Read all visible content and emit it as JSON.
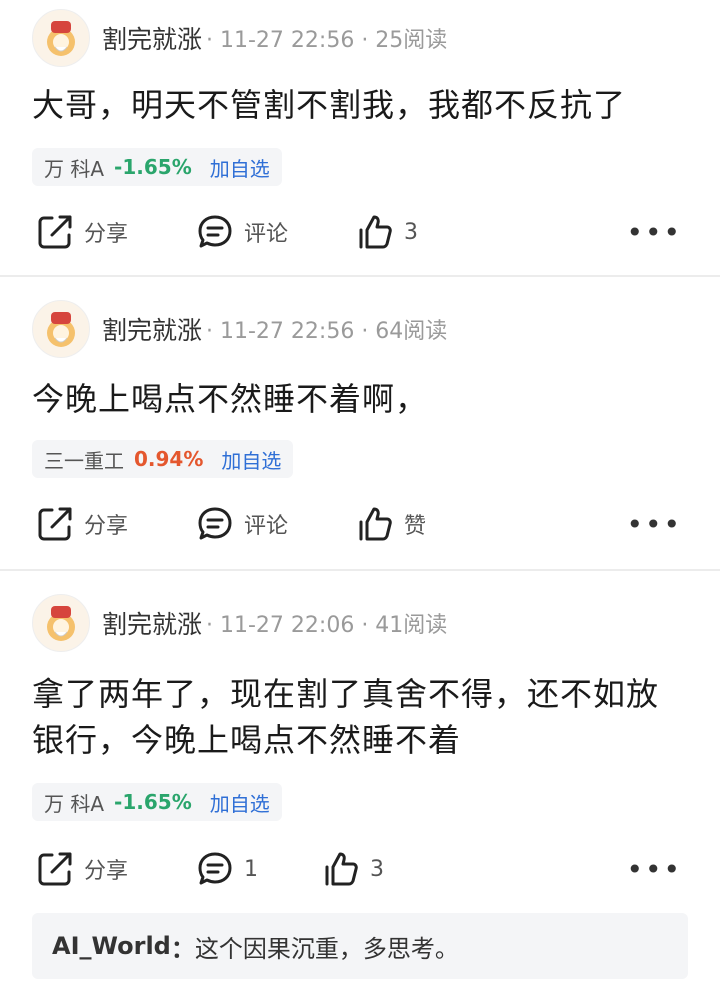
{
  "posts": [
    {
      "username": "割完就涨",
      "meta": "· 11-27 22:56 · 25阅读",
      "text": "大哥，明天不管割不割我，我都不反抗了",
      "stock": {
        "name": "万 科A",
        "change": "-1.65%",
        "direction": "down",
        "fav": "加自选"
      },
      "share": "分享",
      "comment": "评论",
      "like": "3"
    },
    {
      "username": "割完就涨",
      "meta": "· 11-27 22:56 · 64阅读",
      "text": "今晚上喝点不然睡不着啊，",
      "stock": {
        "name": "三一重工",
        "change": "0.94%",
        "direction": "up",
        "fav": "加自选"
      },
      "share": "分享",
      "comment": "评论",
      "like": "赞"
    },
    {
      "username": "割完就涨",
      "meta": "· 11-27 22:06 · 41阅读",
      "text_line1": "拿了两年了，现在割了真舍不得，还不如放",
      "text_line2": "银行，今晚上喝点不然睡不着",
      "stock": {
        "name": "万 科A",
        "change": "-1.65%",
        "direction": "down",
        "fav": "加自选"
      },
      "share": "分享",
      "comment": "1",
      "like": "3",
      "reply": {
        "user": "AI_World",
        "sep": "：",
        "text": "这个因果沉重，多思考。"
      }
    }
  ],
  "colors": {
    "down": "#2aa56c",
    "up": "#e4572e",
    "link": "#2f6fd6"
  },
  "icons": [
    "avatar-image",
    "share-icon",
    "comment-icon",
    "like-icon",
    "more-icon"
  ]
}
